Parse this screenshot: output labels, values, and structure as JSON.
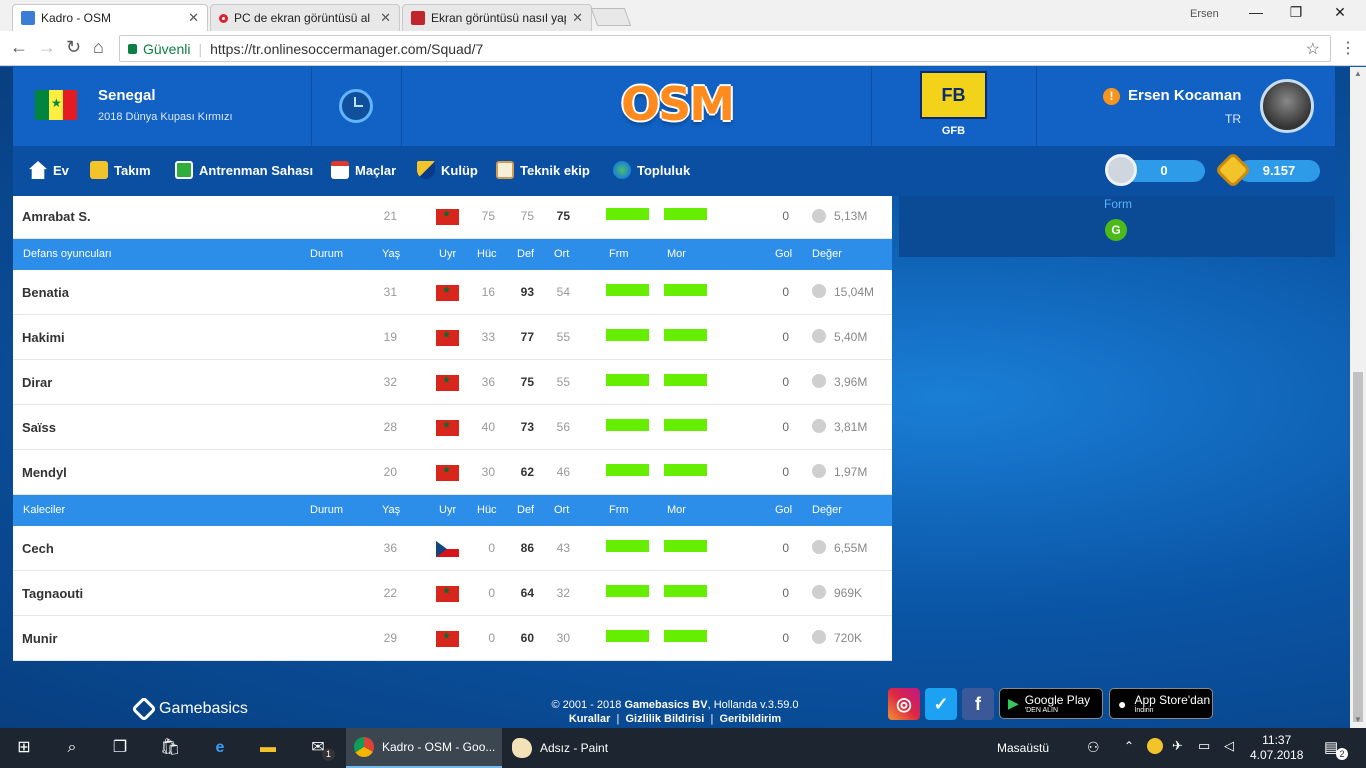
{
  "browser": {
    "tabs": [
      {
        "title": "Kadro - OSM",
        "active": true
      },
      {
        "title": "PC de ekran görüntüsü al",
        "active": false
      },
      {
        "title": "Ekran görüntüsü nasıl yap",
        "active": false
      }
    ],
    "user": "Ersen",
    "secure_label": "Güvenli",
    "url": "https://tr.onlinesoccermanager.com/Squad/7"
  },
  "header": {
    "team": "Senegal",
    "league": "2018 Dünya Kupası Kırmızı",
    "logo": "OSM",
    "club_badge": "FB",
    "club_abbr": "GFB",
    "user_name": "Ersen Kocaman",
    "user_country": "TR",
    "alert": "!"
  },
  "nav": {
    "items": [
      "Ev",
      "Takım",
      "Antrenman Sahası",
      "Maçlar",
      "Kulüp",
      "Teknik ekip",
      "Topluluk"
    ],
    "savings": "0",
    "coins": "9.157"
  },
  "form": {
    "label": "Form",
    "value": "G"
  },
  "squad": {
    "top_row": {
      "name": "Amrabat S.",
      "age": "21",
      "flag": "MA",
      "att": "75",
      "def": "75",
      "mid": "75",
      "goals": "0",
      "value": "5,13M"
    },
    "columns": {
      "status": "Durum",
      "age": "Yaş",
      "nat": "Uyr",
      "att": "Hüc",
      "def": "Def",
      "mid": "Ort",
      "form": "Frm",
      "morale": "Mor",
      "goals": "Gol",
      "value": "Değer"
    },
    "defenders_title": "Defans oyuncuları",
    "defenders": [
      {
        "name": "Benatia",
        "age": "31",
        "flag": "MA",
        "att": "16",
        "def": "93",
        "mid": "54",
        "goals": "0",
        "value": "15,04M"
      },
      {
        "name": "Hakimi",
        "age": "19",
        "flag": "MA",
        "att": "33",
        "def": "77",
        "mid": "55",
        "goals": "0",
        "value": "5,40M"
      },
      {
        "name": "Dirar",
        "age": "32",
        "flag": "MA",
        "att": "36",
        "def": "75",
        "mid": "55",
        "goals": "0",
        "value": "3,96M"
      },
      {
        "name": "Saïss",
        "age": "28",
        "flag": "MA",
        "att": "40",
        "def": "73",
        "mid": "56",
        "goals": "0",
        "value": "3,81M"
      },
      {
        "name": "Mendyl",
        "age": "20",
        "flag": "MA",
        "att": "30",
        "def": "62",
        "mid": "46",
        "goals": "0",
        "value": "1,97M"
      }
    ],
    "keepers_title": "Kaleciler",
    "keepers": [
      {
        "name": "Cech",
        "age": "36",
        "flag": "CZ",
        "att": "0",
        "def": "86",
        "mid": "43",
        "goals": "0",
        "value": "6,55M"
      },
      {
        "name": "Tagnaouti",
        "age": "22",
        "flag": "MA",
        "att": "0",
        "def": "64",
        "mid": "32",
        "goals": "0",
        "value": "969K"
      },
      {
        "name": "Munir",
        "age": "29",
        "flag": "MA",
        "att": "0",
        "def": "60",
        "mid": "30",
        "goals": "0",
        "value": "720K"
      }
    ]
  },
  "footer": {
    "brand": "Gamebasics",
    "copyright": "© 2001 - 2018",
    "company": "Gamebasics BV",
    "location": ", Hollanda v.3.59.0",
    "links": [
      "Kurallar",
      "Gizlilik Bildirisi",
      "Geribildirim"
    ],
    "google_play": {
      "main": "Google Play",
      "sub": "'DEN ALIN"
    },
    "app_store": {
      "main": "App Store'dan",
      "sub": "İndirin"
    }
  },
  "taskbar": {
    "apps": [
      "Kadro - OSM - Goo...",
      "Adsız - Paint"
    ],
    "desktop_label": "Masaüstü",
    "time": "11:37",
    "date": "4.07.2018",
    "notifications": "2",
    "mail_badge": "1"
  },
  "colors": {
    "accent": "#2c8ee8",
    "bar": "#66ee00",
    "nav": "#0a4fa2",
    "header": "#1162c4"
  }
}
